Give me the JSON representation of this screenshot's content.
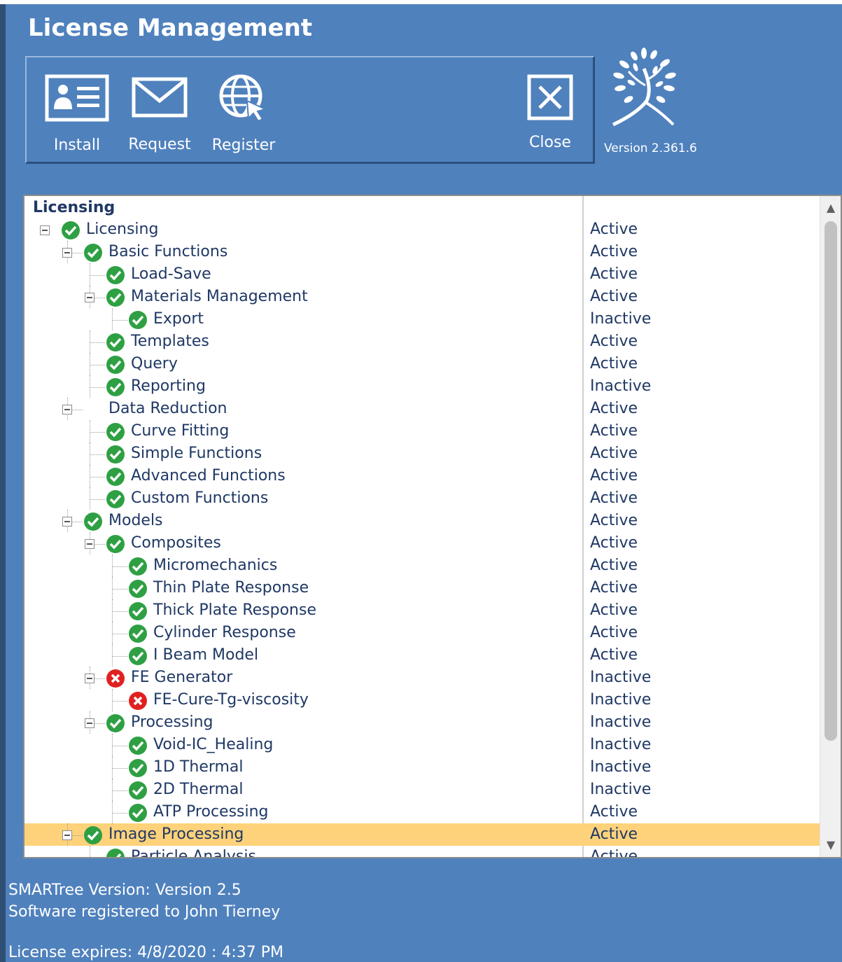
{
  "window": {
    "title": "License Management"
  },
  "toolbar": {
    "install_label": "Install",
    "request_label": "Request",
    "register_label": "Register",
    "close_label": "Close"
  },
  "brand": {
    "icon": "tree-logo-icon",
    "version": "Version 2.361.6"
  },
  "tree": {
    "header": "Licensing",
    "rows": [
      {
        "name": "Licensing",
        "status": "Active",
        "depth": 0,
        "icon": "check",
        "expander": true
      },
      {
        "name": "Basic Functions",
        "status": "Active",
        "depth": 1,
        "icon": "check",
        "expander": true
      },
      {
        "name": "Load-Save",
        "status": "Active",
        "depth": 2,
        "icon": "check",
        "expander": false
      },
      {
        "name": "Materials Management",
        "status": "Active",
        "depth": 2,
        "icon": "check",
        "expander": true
      },
      {
        "name": "Export",
        "status": "Inactive",
        "depth": 3,
        "icon": "check",
        "expander": false
      },
      {
        "name": "Templates",
        "status": "Active",
        "depth": 2,
        "icon": "check",
        "expander": false
      },
      {
        "name": "Query",
        "status": "Active",
        "depth": 2,
        "icon": "check",
        "expander": false
      },
      {
        "name": "Reporting",
        "status": "Inactive",
        "depth": 2,
        "icon": "check",
        "expander": false
      },
      {
        "name": "Data Reduction",
        "status": "Active",
        "depth": 1,
        "icon": "none",
        "expander": true
      },
      {
        "name": "Curve Fitting",
        "status": "Active",
        "depth": 2,
        "icon": "check",
        "expander": false
      },
      {
        "name": "Simple Functions",
        "status": "Active",
        "depth": 2,
        "icon": "check",
        "expander": false
      },
      {
        "name": "Advanced Functions",
        "status": "Active",
        "depth": 2,
        "icon": "check",
        "expander": false
      },
      {
        "name": "Custom Functions",
        "status": "Active",
        "depth": 2,
        "icon": "check",
        "expander": false
      },
      {
        "name": "Models",
        "status": "Active",
        "depth": 1,
        "icon": "check",
        "expander": true
      },
      {
        "name": "Composites",
        "status": "Active",
        "depth": 2,
        "icon": "check",
        "expander": true
      },
      {
        "name": "Micromechanics",
        "status": "Active",
        "depth": 3,
        "icon": "check",
        "expander": false
      },
      {
        "name": "Thin Plate Response",
        "status": "Active",
        "depth": 3,
        "icon": "check",
        "expander": false
      },
      {
        "name": "Thick Plate Response",
        "status": "Active",
        "depth": 3,
        "icon": "check",
        "expander": false
      },
      {
        "name": "Cylinder Response",
        "status": "Active",
        "depth": 3,
        "icon": "check",
        "expander": false
      },
      {
        "name": "I Beam Model",
        "status": "Active",
        "depth": 3,
        "icon": "check",
        "expander": false
      },
      {
        "name": "FE Generator",
        "status": "Inactive",
        "depth": 2,
        "icon": "error",
        "expander": true
      },
      {
        "name": "FE-Cure-Tg-viscosity",
        "status": "Inactive",
        "depth": 3,
        "icon": "error",
        "expander": false
      },
      {
        "name": "Processing",
        "status": "Inactive",
        "depth": 2,
        "icon": "check",
        "expander": true
      },
      {
        "name": "Void-IC_Healing",
        "status": "Inactive",
        "depth": 3,
        "icon": "check",
        "expander": false
      },
      {
        "name": "1D Thermal",
        "status": "Inactive",
        "depth": 3,
        "icon": "check",
        "expander": false
      },
      {
        "name": "2D Thermal",
        "status": "Inactive",
        "depth": 3,
        "icon": "check",
        "expander": false
      },
      {
        "name": "ATP Processing",
        "status": "Active",
        "depth": 3,
        "icon": "check",
        "expander": false
      },
      {
        "name": "Image Processing",
        "status": "Active",
        "depth": 1,
        "icon": "check",
        "expander": true,
        "selected": true
      },
      {
        "name": "Particle Analysis",
        "status": "Active",
        "depth": 2,
        "icon": "check",
        "expander": false
      }
    ]
  },
  "footer": {
    "smartree_version": "SMARTree Version: Version 2.5",
    "registered_to": "Software registered to John Tierney",
    "license_expires": "License expires: 4/8/2020 : 4:37 PM"
  },
  "colors": {
    "background": "#4f81bd",
    "selection": "#fdd27a",
    "text": "#1f3864",
    "check": "#2ea043",
    "error": "#e02020"
  }
}
